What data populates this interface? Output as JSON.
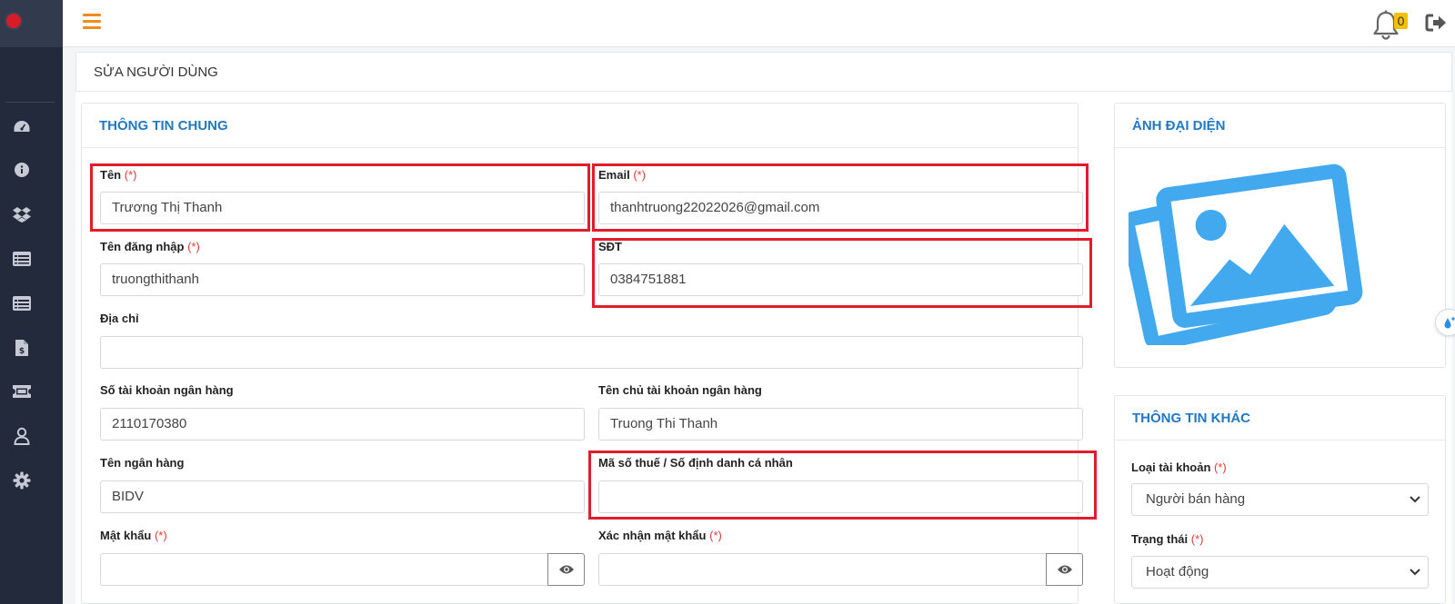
{
  "header": {
    "notification_count": "0"
  },
  "page": {
    "title": "SỬA NGƯỜI DÙNG"
  },
  "general": {
    "title": "THÔNG TIN CHUNG",
    "required_mark": "(*)",
    "name": {
      "label": "Tên",
      "value": "Trương Thị Thanh"
    },
    "email": {
      "label": "Email",
      "value": "thanhtruong22022026@gmail.com"
    },
    "username": {
      "label": "Tên đăng nhập",
      "value": "truongthithanh"
    },
    "phone": {
      "label": "SĐT",
      "value": "0384751881"
    },
    "address": {
      "label": "Địa chỉ",
      "value": ""
    },
    "bank_account": {
      "label": "Số tài khoản ngân hàng",
      "value": "2110170380"
    },
    "bank_holder": {
      "label": "Tên chủ tài khoản ngân hàng",
      "value": "Truong Thi Thanh"
    },
    "bank_name": {
      "label": "Tên ngân hàng",
      "value": "BIDV"
    },
    "tax_id": {
      "label": "Mã số thuế / Số định danh cá nhân",
      "value": ""
    },
    "password": {
      "label": "Mật khẩu",
      "value": ""
    },
    "confirm_password": {
      "label": "Xác nhận mật khẩu",
      "value": ""
    }
  },
  "avatar": {
    "title": "ẢNH ĐẠI DIỆN"
  },
  "other": {
    "title": "THÔNG TIN KHÁC",
    "account_type": {
      "label": "Loại tài khoản",
      "value": "Người bán hàng"
    },
    "status": {
      "label": "Trạng thái",
      "value": "Hoạt động"
    }
  },
  "colors": {
    "accent": "#2178c4",
    "sidebar": "#232a3b",
    "highlight": "#e11d2b",
    "menu_icon": "#f08c1e",
    "required": "#e53935"
  },
  "icons": [
    "logo-icon",
    "dashboard-icon",
    "info-icon",
    "dropbox-icon",
    "list-icon",
    "table-icon",
    "invoice-icon",
    "ticket-icon",
    "user-icon",
    "gear-icon",
    "hamburger-icon",
    "bell-icon",
    "logout-icon",
    "eye-icon",
    "image-placeholder-icon",
    "chevron-down-icon",
    "water-drop-icon"
  ]
}
